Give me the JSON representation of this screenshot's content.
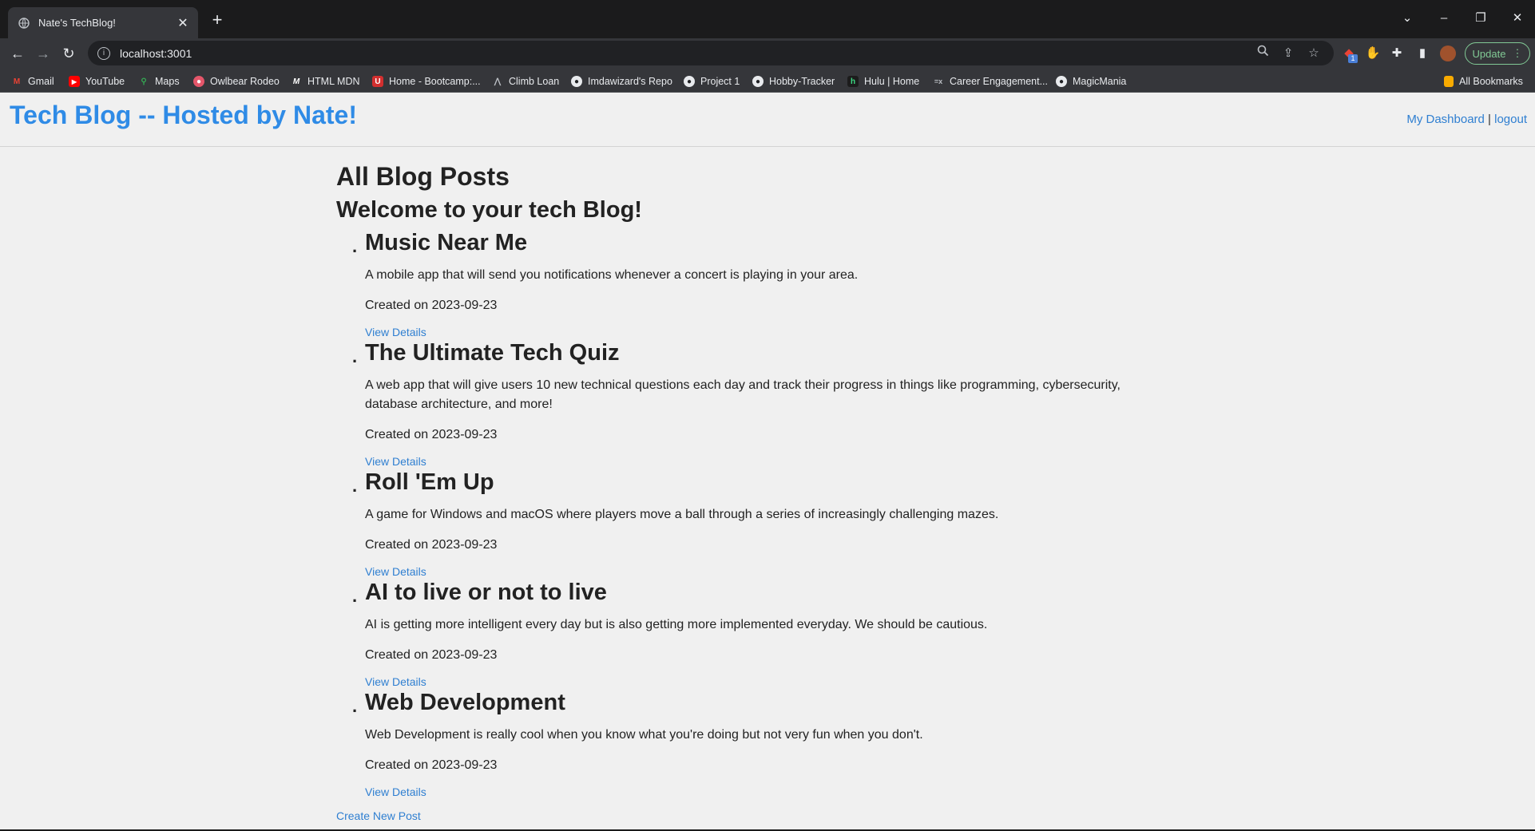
{
  "browser": {
    "tab_title": "Nate's TechBlog!",
    "url": "localhost:3001",
    "update_label": "Update",
    "extension_badge": "1",
    "bookmarks": [
      {
        "label": "Gmail",
        "icon": "gmail-icon"
      },
      {
        "label": "YouTube",
        "icon": "youtube-icon"
      },
      {
        "label": "Maps",
        "icon": "maps-icon"
      },
      {
        "label": "Owlbear Rodeo",
        "icon": "owlbear-icon"
      },
      {
        "label": "HTML MDN",
        "icon": "mdn-icon"
      },
      {
        "label": "Home - Bootcamp:...",
        "icon": "bootcamp-icon"
      },
      {
        "label": "Climb Loan",
        "icon": "climb-icon"
      },
      {
        "label": "Imdawizard's Repo",
        "icon": "github-icon"
      },
      {
        "label": "Project 1",
        "icon": "github-icon"
      },
      {
        "label": "Hobby-Tracker",
        "icon": "github-icon"
      },
      {
        "label": "Hulu | Home",
        "icon": "hulu-icon"
      },
      {
        "label": "Career Engagement...",
        "icon": "career-icon"
      },
      {
        "label": "MagicMania",
        "icon": "github-icon"
      }
    ],
    "all_bookmarks": "All Bookmarks"
  },
  "site": {
    "title": "Tech Blog -- Hosted by Nate!",
    "nav": {
      "dashboard": "My Dashboard",
      "separator": "|",
      "logout": "logout"
    }
  },
  "main": {
    "heading": "All Blog Posts",
    "welcome": "Welcome to your tech Blog!",
    "posts": [
      {
        "title": "Music Near Me",
        "description": "A mobile app that will send you notifications whenever a concert is playing in your area.",
        "date": "Created on 2023-09-23",
        "link": "View Details"
      },
      {
        "title": "The Ultimate Tech Quiz",
        "description": "A web app that will give users 10 new technical questions each day and track their progress in things like programming, cybersecurity, database architecture, and more!",
        "date": "Created on 2023-09-23",
        "link": "View Details"
      },
      {
        "title": "Roll 'Em Up",
        "description": "A game for Windows and macOS where players move a ball through a series of increasingly challenging mazes.",
        "date": "Created on 2023-09-23",
        "link": "View Details"
      },
      {
        "title": "AI to live or not to live",
        "description": "AI is getting more intelligent every day but is also getting more implemented everyday. We should be cautious.",
        "date": "Created on 2023-09-23",
        "link": "View Details"
      },
      {
        "title": "Web Development",
        "description": "Web Development is really cool when you know what you're doing but not very fun when you don't.",
        "date": "Created on 2023-09-23",
        "link": "View Details"
      }
    ],
    "create_link": "Create New Post"
  }
}
